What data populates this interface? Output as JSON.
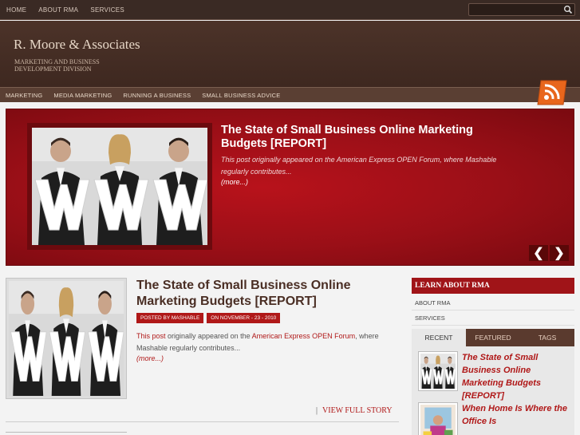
{
  "topnav": {
    "items": [
      {
        "label": "HOME"
      },
      {
        "label": "ABOUT RMA"
      },
      {
        "label": "SERVICES"
      }
    ]
  },
  "search": {
    "placeholder": ""
  },
  "header": {
    "title": "R. Moore & Associates",
    "tagline": "MARKETING AND BUSINESS DEVELOPMENT DIVISION"
  },
  "catnav": {
    "items": [
      {
        "label": "MARKETING"
      },
      {
        "label": "MEDIA MARKETING"
      },
      {
        "label": "RUNNING A BUSINESS"
      },
      {
        "label": "SMALL BUSINESS ADVICE"
      }
    ]
  },
  "slider": {
    "title": "The State of Small Business Online Marketing Budgets [REPORT]",
    "excerpt": "This post originally appeared on the American Express OPEN Forum, where Mashable regularly contributes...",
    "more": "(more...)",
    "prev": "❮",
    "next": "❯"
  },
  "post": {
    "title": "The State of Small Business Online Marketing Budgets [REPORT]",
    "author": "POSTED BY MASHABLE",
    "date": "ON NOVEMBER - 23 - 2010",
    "excerpt_link1": "This post",
    "excerpt_text1": " originally appeared on the ",
    "excerpt_link2": "American Express OPEN Forum",
    "excerpt_text2": ", where Mashable regularly contributes...",
    "more": "(more...)",
    "separator": "|",
    "full_story": "VIEW FULL STORY"
  },
  "sidebar": {
    "heading": "LEARN ABOUT RMA",
    "links": [
      {
        "label": "ABOUT RMA"
      },
      {
        "label": "SERVICES"
      }
    ],
    "tabs": [
      {
        "label": "RECENT"
      },
      {
        "label": "FEATURED"
      },
      {
        "label": "TAGS"
      }
    ],
    "recent": [
      {
        "title": "The State of Small Business Online Marketing Budgets [REPORT]"
      },
      {
        "title": "When Home Is Where the Office Is"
      }
    ]
  },
  "colors": {
    "accent": "#b01818",
    "header_bg": "#4c3329",
    "nav_bg": "#5a3f33"
  },
  "icons": {
    "search": "search-icon",
    "rss": "rss-icon"
  }
}
